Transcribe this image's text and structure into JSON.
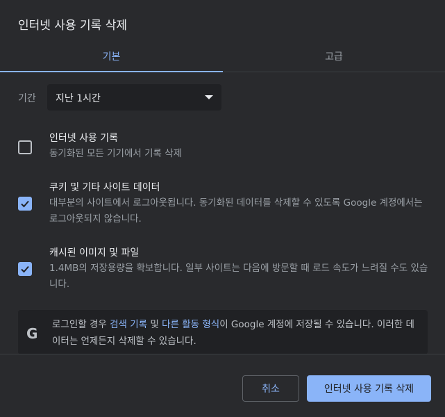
{
  "dialog": {
    "title": "인터넷 사용 기록 삭제"
  },
  "tabs": [
    {
      "label": "기본",
      "selected": true
    },
    {
      "label": "고급",
      "selected": false
    }
  ],
  "time_range": {
    "label": "기간",
    "value": "지난 1시간"
  },
  "options": [
    {
      "title": "인터넷 사용 기록",
      "description": "동기화된 모든 기기에서 기록 삭제",
      "checked": false
    },
    {
      "title": "쿠키 및 기타 사이트 데이터",
      "description": "대부분의 사이트에서 로그아웃됩니다. 동기화된 데이터를 삭제할 수 있도록 Google 계정에서는 로그아웃되지 않습니다.",
      "checked": true
    },
    {
      "title": "캐시된 이미지 및 파일",
      "description": "1.4MB의 저장용량을 확보합니다. 일부 사이트는 다음에 방문할 때 로드 속도가 느려질 수도 있습니다.",
      "checked": true
    }
  ],
  "info": {
    "icon": "google-g-icon",
    "text_before": "로그인할 경우 ",
    "link1": "검색 기록",
    "text_mid1": " 및 ",
    "link2": "다른 활동 형식",
    "text_after": "이 Google 계정에 저장될 수 있습니다. 이러한 데이터는 언제든지 삭제할 수 있습니다."
  },
  "buttons": {
    "cancel": "취소",
    "confirm": "인터넷 사용 기록 삭제"
  },
  "colors": {
    "background": "#292a2d",
    "accent": "#8ab4f8",
    "panel": "#202124",
    "text": "#e8eaed",
    "secondary_text": "#9aa0a6"
  }
}
